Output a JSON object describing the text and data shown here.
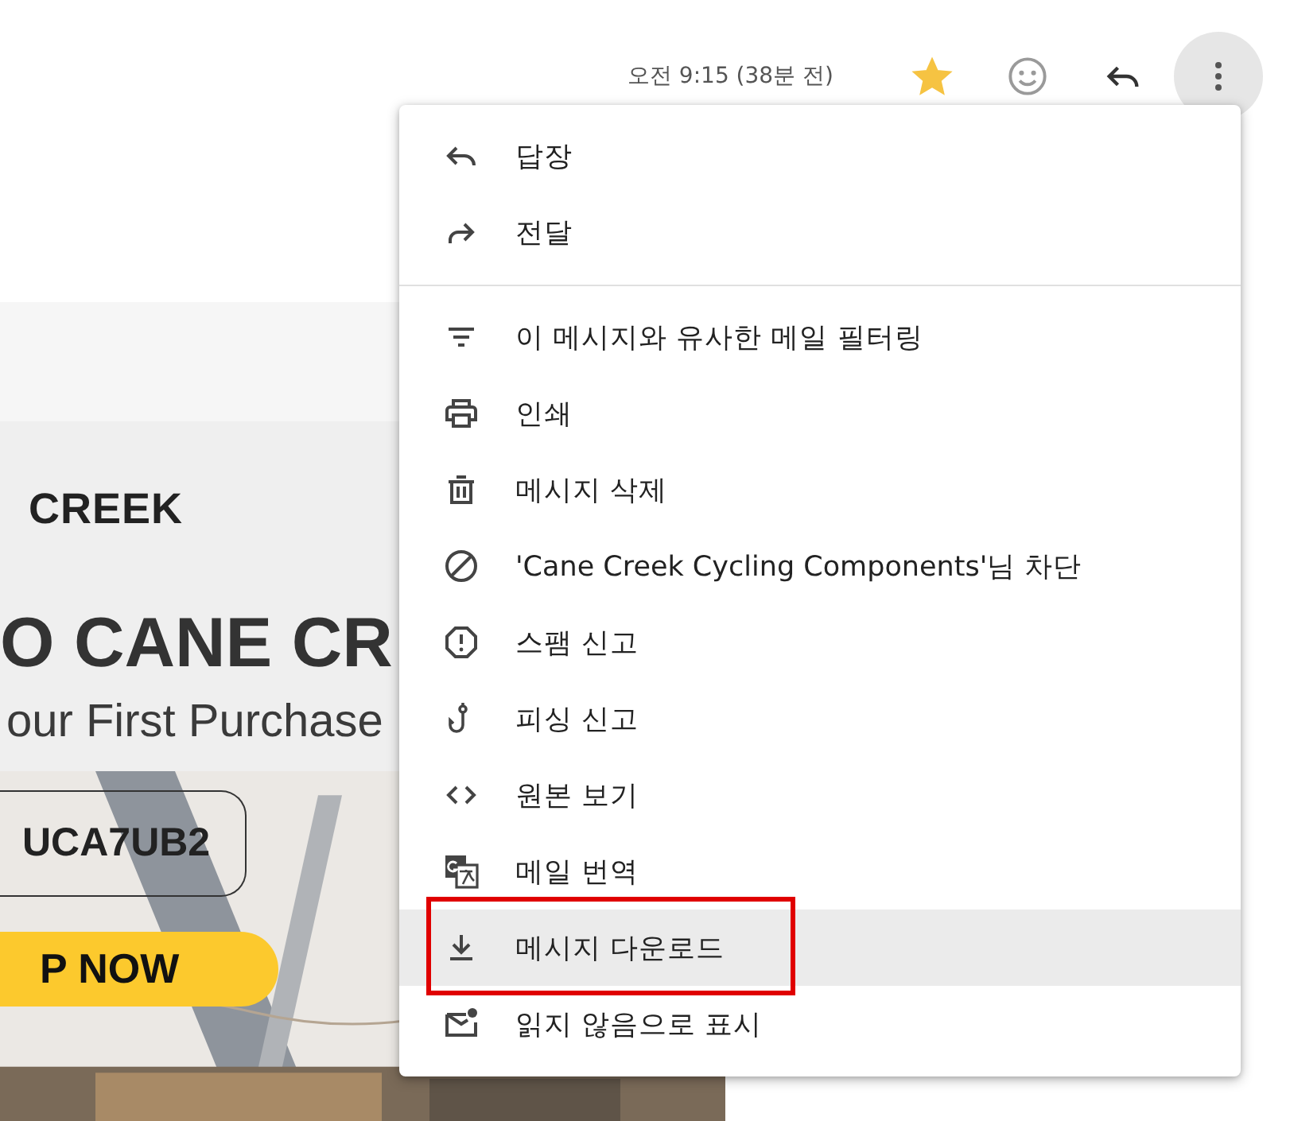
{
  "header": {
    "time": "오전 9:15 (38분 전)",
    "starred": true
  },
  "email": {
    "logo": "CREEK",
    "headline": "O CANE CR",
    "subhead": "our First Purchase",
    "code": "UCA7UB2",
    "cta": "P NOW"
  },
  "menu": {
    "groups": [
      [
        {
          "kind": "reply",
          "label": "답장",
          "highlighted": false,
          "outlined": false
        },
        {
          "kind": "forward",
          "label": "전달",
          "highlighted": false,
          "outlined": false
        }
      ],
      [
        {
          "kind": "filter",
          "label": "이 메시지와 유사한 메일 필터링",
          "highlighted": false,
          "outlined": false
        },
        {
          "kind": "print",
          "label": "인쇄",
          "highlighted": false,
          "outlined": false
        },
        {
          "kind": "delete",
          "label": "메시지 삭제",
          "highlighted": false,
          "outlined": false
        },
        {
          "kind": "block",
          "label": "'Cane Creek Cycling Components'님 차단",
          "highlighted": false,
          "outlined": false
        },
        {
          "kind": "spam",
          "label": "스팸 신고",
          "highlighted": false,
          "outlined": false
        },
        {
          "kind": "phishing",
          "label": "피싱 신고",
          "highlighted": false,
          "outlined": false
        },
        {
          "kind": "source",
          "label": "원본 보기",
          "highlighted": false,
          "outlined": false
        },
        {
          "kind": "translate",
          "label": "메일 번역",
          "highlighted": false,
          "outlined": false
        },
        {
          "kind": "download",
          "label": "메시지 다운로드",
          "highlighted": true,
          "outlined": true
        },
        {
          "kind": "unread",
          "label": "읽지 않음으로 표시",
          "highlighted": false,
          "outlined": false
        }
      ]
    ]
  }
}
